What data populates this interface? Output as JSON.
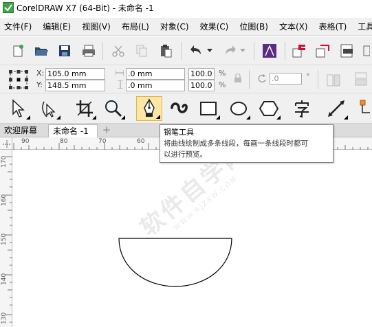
{
  "window": {
    "title": "CorelDRAW X7 (64-Bit) - 未命名 -1"
  },
  "menu": [
    {
      "label": "文件(F)"
    },
    {
      "label": "编辑(E)"
    },
    {
      "label": "视图(V)"
    },
    {
      "label": "布局(L)"
    },
    {
      "label": "对象(C)"
    },
    {
      "label": "效果(C)"
    },
    {
      "label": "位图(B)"
    },
    {
      "label": "文本(X)"
    },
    {
      "label": "表格(T)"
    },
    {
      "label": "工具"
    }
  ],
  "property_bar": {
    "x_label": "X:",
    "x_value": "105.0 mm",
    "y_label": "Y:",
    "y_value": "148.5 mm",
    "width_value": ".0 mm",
    "height_value": ".0 mm",
    "scale_x": "100.0",
    "scale_y": "100.0",
    "percent": "%",
    "angle_value": ".0",
    "degree": "°"
  },
  "tabs": {
    "welcome": "欢迎屏幕",
    "document": "未命名 -1",
    "add": "+"
  },
  "ruler": {
    "horizontal_ticks": [
      "90",
      "80",
      "70",
      "60"
    ],
    "vertical_ticks": [
      "170",
      "160",
      "150",
      "140",
      "130"
    ]
  },
  "tooltip": {
    "title": "钢笔工具",
    "desc_line1": "将曲线绘制成多条线段，每画一条线段时都可",
    "desc_line2": "以进行预览。"
  },
  "watermark": {
    "main": "软件自学网",
    "sub": "WWW.RJZXW.COM"
  },
  "colors": {
    "accent": "#fde7a6",
    "purple": "#5b2c83"
  }
}
